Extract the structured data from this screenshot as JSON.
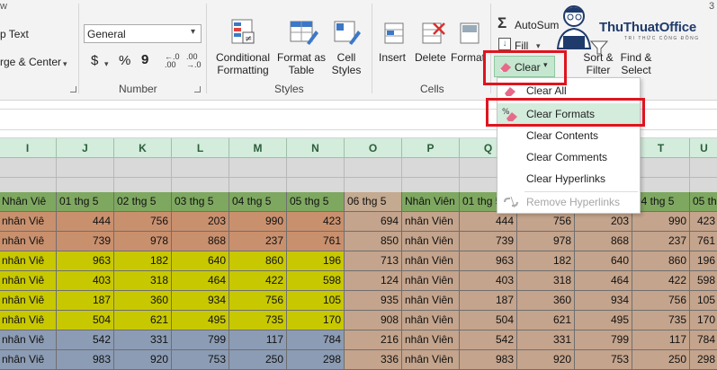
{
  "ribbon": {
    "alignment": {
      "wrap_text": "p Text",
      "merge_center": "rge & Center"
    },
    "number": {
      "format": "General",
      "dollar": "$",
      "percent": "%",
      "comma": "9",
      "inc_dec": ".00",
      "dec_dec": "→.0",
      "group": "Number"
    },
    "styles": {
      "conditional": [
        "Conditional",
        "Formatting"
      ],
      "format_table": [
        "Format as",
        "Table"
      ],
      "cell_styles": [
        "Cell",
        "Styles"
      ],
      "group": "Styles"
    },
    "cells": {
      "insert": "Insert",
      "delete": "Delete",
      "format": "Format",
      "group": "Cells"
    },
    "editing": {
      "autosum": "AutoSum",
      "fill": "Fill",
      "clear": "Clear",
      "sort_filter": [
        "Sort &",
        "Filter"
      ],
      "find_select": [
        "Find &",
        "Select"
      ]
    },
    "top_left": "w",
    "top_right": "3"
  },
  "watermark": {
    "brand": "ThuThuatOffice",
    "tagline": "TRI THỨC CỘNG ĐỒNG"
  },
  "clear_menu": {
    "items": [
      {
        "label": "Clear All",
        "enabled": true
      },
      {
        "label": "Clear Formats",
        "enabled": true,
        "highlighted": true
      },
      {
        "label": "Clear Contents",
        "enabled": true
      },
      {
        "label": "Clear Comments",
        "enabled": true
      },
      {
        "label": "Clear Hyperlinks",
        "enabled": true
      },
      {
        "label": "Remove Hyperlinks",
        "enabled": false
      }
    ]
  },
  "sheet": {
    "columns": [
      "I",
      "J",
      "K",
      "L",
      "M",
      "N",
      "O",
      "P",
      "Q",
      "R",
      "S",
      "T",
      "U"
    ],
    "header_row": [
      "Nhân Viê",
      "01 thg 5",
      "02 thg 5",
      "03 thg 5",
      "04 thg 5",
      "05 thg 5",
      "06 thg 5",
      "Nhân Viên",
      "01 thg 5",
      "02 thg 5",
      "03 thg 5",
      "04 thg 5",
      "05 thg 5"
    ],
    "rows": [
      {
        "color": "#c9906e",
        "cells": [
          "nhân Viê",
          "444",
          "756",
          "203",
          "990",
          "423",
          "694",
          "nhân Viên",
          "444",
          "756",
          "203",
          "990",
          "423"
        ]
      },
      {
        "color": "#c9906e",
        "cells": [
          "nhân Viê",
          "739",
          "978",
          "868",
          "237",
          "761",
          "850",
          "nhân Viên",
          "739",
          "978",
          "868",
          "237",
          "761"
        ]
      },
      {
        "color": "#c8c800",
        "cells": [
          "nhân Viê",
          "963",
          "182",
          "640",
          "860",
          "196",
          "713",
          "nhân Viên",
          "963",
          "182",
          "640",
          "860",
          "196"
        ]
      },
      {
        "color": "#c8c800",
        "cells": [
          "nhân Viê",
          "403",
          "318",
          "464",
          "422",
          "598",
          "124",
          "nhân Viên",
          "403",
          "318",
          "464",
          "422",
          "598"
        ]
      },
      {
        "color": "#c8c800",
        "cells": [
          "nhân Viê",
          "187",
          "360",
          "934",
          "756",
          "105",
          "935",
          "nhân Viên",
          "187",
          "360",
          "934",
          "756",
          "105"
        ]
      },
      {
        "color": "#c8c800",
        "cells": [
          "nhân Viê",
          "504",
          "621",
          "495",
          "735",
          "170",
          "908",
          "nhân Viên",
          "504",
          "621",
          "495",
          "735",
          "170"
        ]
      },
      {
        "color": "#8c9cb4",
        "cells": [
          "nhân Viê",
          "542",
          "331",
          "799",
          "117",
          "784",
          "216",
          "nhân Viên",
          "542",
          "331",
          "799",
          "117",
          "784"
        ]
      },
      {
        "color": "#8c9cb4",
        "cells": [
          "nhân Viê",
          "983",
          "920",
          "753",
          "250",
          "298",
          "336",
          "nhân Viên",
          "983",
          "920",
          "753",
          "250",
          "298"
        ]
      }
    ],
    "header_colors": {
      "green": "#7ea860",
      "tan": "#c4aa90"
    },
    "other_block_color": "#c4a48c"
  }
}
